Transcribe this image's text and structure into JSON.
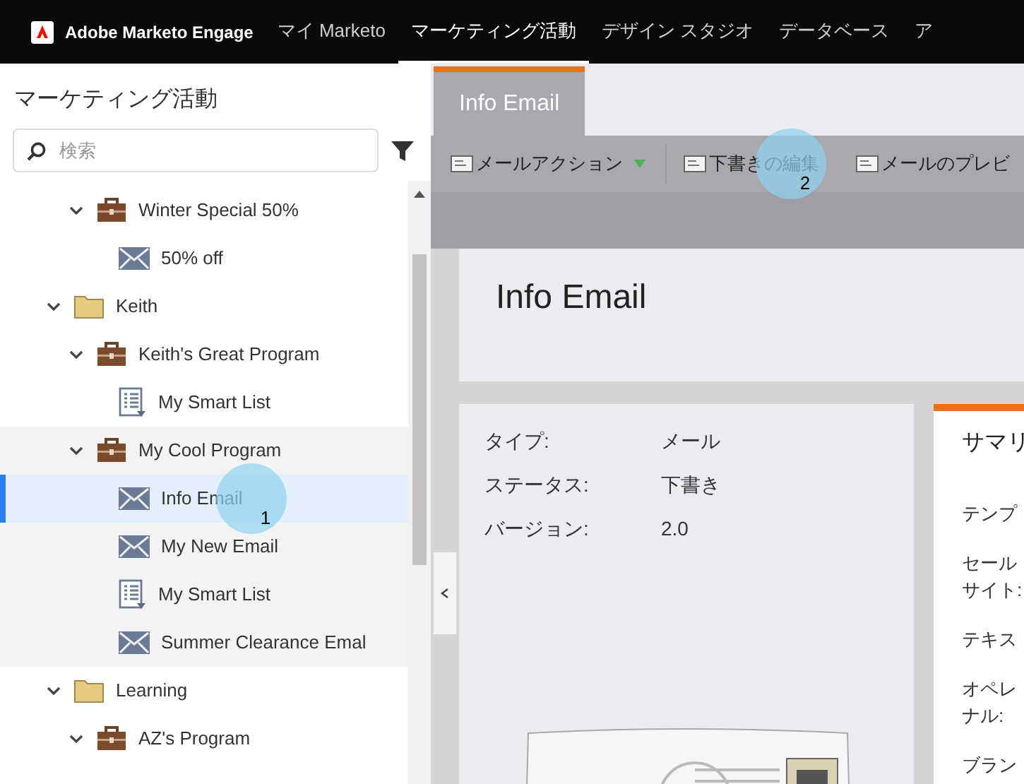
{
  "top_nav": {
    "brand": "Adobe Marketo Engage",
    "items": [
      {
        "label": "マイ Marketo",
        "selected": false
      },
      {
        "label": "マーケティング活動",
        "selected": true
      },
      {
        "label": "デザイン スタジオ",
        "selected": false
      },
      {
        "label": "データベース",
        "selected": false
      },
      {
        "label": "ア",
        "selected": false
      }
    ]
  },
  "sidebar": {
    "title": "マーケティング活動",
    "search": {
      "placeholder": "検索"
    },
    "tree_continued": [
      {
        "kind": "program",
        "label": "Winter Special 50%",
        "expanded": true,
        "selected": false,
        "children": [
          {
            "kind": "email",
            "label": "50% off",
            "selected": false
          }
        ]
      }
    ],
    "tree": [
      {
        "kind": "folder",
        "label": "Keith",
        "expanded": true,
        "selected": false,
        "children": [
          {
            "kind": "program",
            "label": "Keith's Great Program",
            "expanded": true,
            "selected": false,
            "children": [
              {
                "kind": "list",
                "label": "My Smart List",
                "selected": false
              }
            ]
          },
          {
            "kind": "program",
            "label": "My Cool Program",
            "expanded": true,
            "selected": false,
            "highlighted": true,
            "children": [
              {
                "kind": "email",
                "label": "Info Email",
                "selected": true,
                "step": "1"
              },
              {
                "kind": "email",
                "label": "My New Email",
                "selected": false
              },
              {
                "kind": "list",
                "label": "My Smart List",
                "selected": false
              },
              {
                "kind": "email",
                "label": "Summer Clearance Emal",
                "selected": false
              }
            ]
          }
        ]
      },
      {
        "kind": "folder",
        "label": "Learning",
        "expanded": true,
        "selected": false,
        "children": [
          {
            "kind": "program",
            "label": "AZ's Program",
            "expanded": true,
            "selected": false
          }
        ]
      }
    ]
  },
  "tabs": [
    {
      "label": "Info Email",
      "selected": true
    }
  ],
  "toolbar": [
    {
      "label": "メールアクション",
      "dropdown": true
    },
    {
      "label": "下書きの編集",
      "dropdown": false,
      "step": "2"
    },
    {
      "label": "メールのプレビ",
      "dropdown": false
    }
  ],
  "header": {
    "title": "Info Email"
  },
  "details": [
    {
      "label": "タイプ:",
      "value": "メール"
    },
    {
      "label": "ステータス:",
      "value": "下書き"
    },
    {
      "label": "バージョン:",
      "value": "2.0"
    }
  ],
  "summary": {
    "title": "サマリ",
    "rows": [
      [
        "テンプ"
      ],
      [
        "セール",
        "サイト:"
      ],
      [
        "テキス"
      ],
      [
        "オペレ",
        "ナル:"
      ],
      [
        "ブラン"
      ]
    ]
  }
}
